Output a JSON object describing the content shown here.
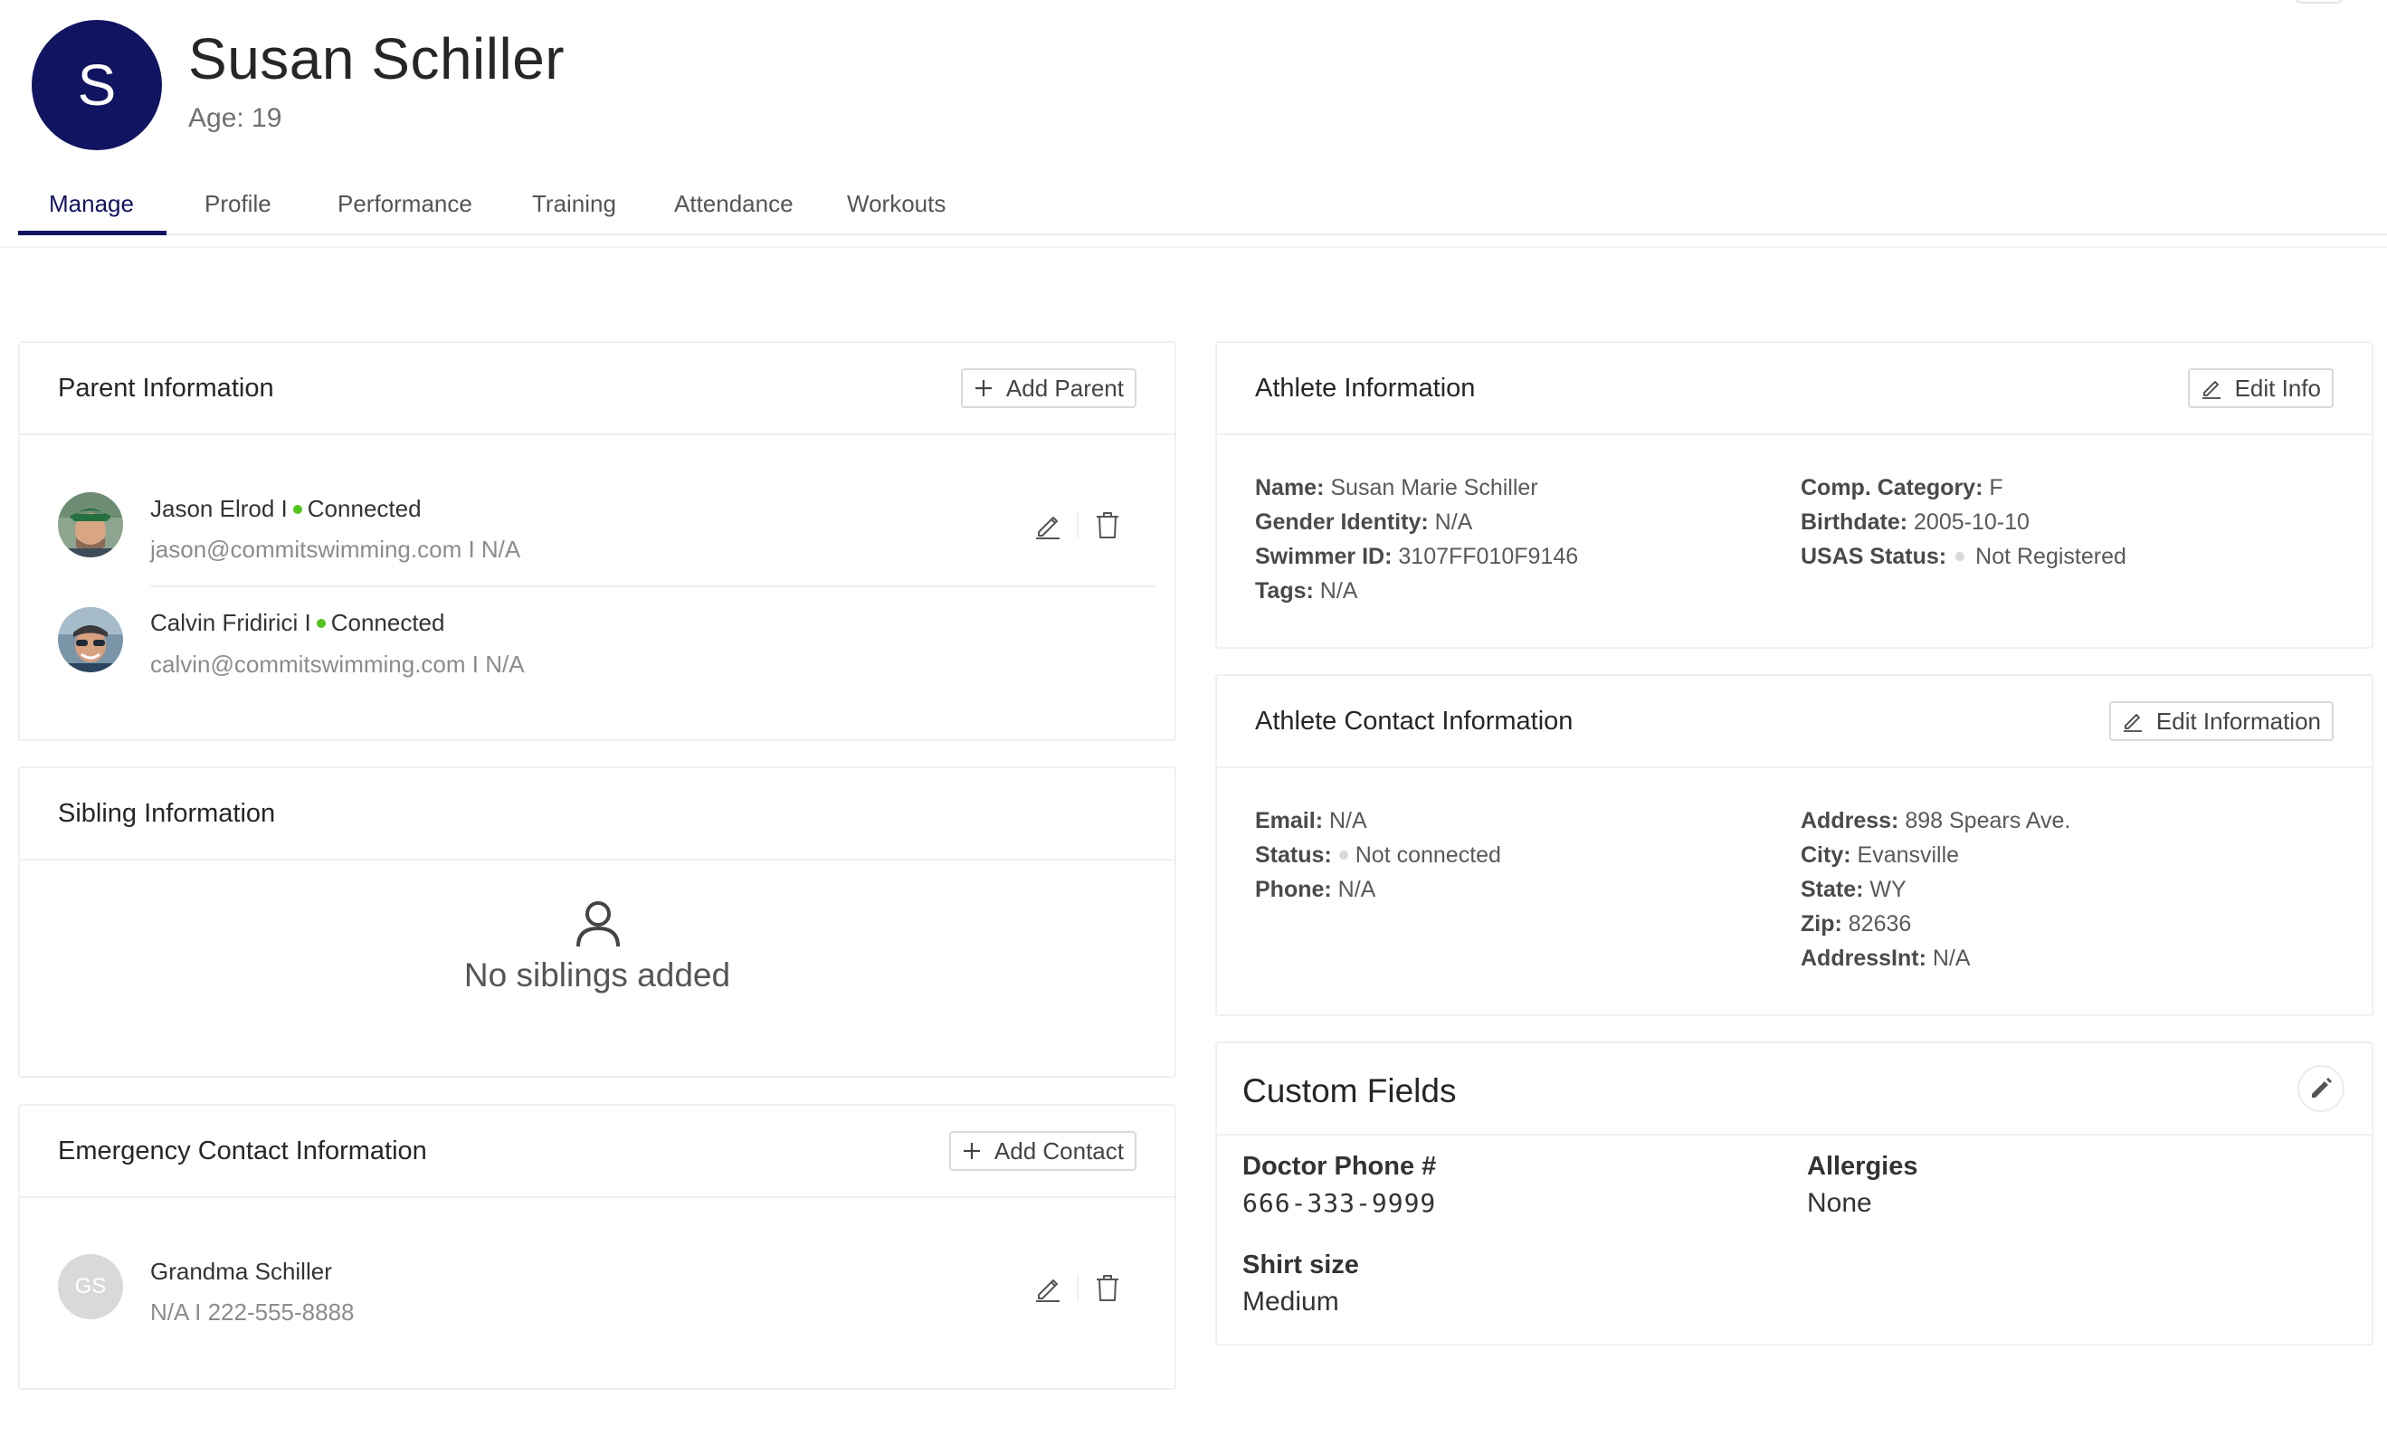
{
  "athlete": {
    "avatar_letter": "S",
    "name": "Susan Schiller",
    "age": "Age: 19"
  },
  "tabs": [
    {
      "label": "Manage"
    },
    {
      "label": "Profile"
    },
    {
      "label": "Performance"
    },
    {
      "label": "Training"
    },
    {
      "label": "Attendance"
    },
    {
      "label": "Workouts"
    }
  ],
  "parent_info": {
    "title": "Parent Information",
    "add_label": "Add Parent",
    "parents": [
      {
        "name": "Jason Elrod",
        "sep": "I",
        "status": "Connected",
        "email_line": "jason@commitswimming.com I N/A"
      },
      {
        "name": "Calvin Fridirici",
        "sep": "I",
        "status": "Connected",
        "email_line": "calvin@commitswimming.com I N/A"
      }
    ],
    "status_color": "#52c41a"
  },
  "sibling_info": {
    "title": "Sibling Information",
    "empty_text": "No siblings added"
  },
  "emergency_info": {
    "title": "Emergency Contact Information",
    "add_label": "Add Contact",
    "contacts": [
      {
        "initials": "GS",
        "name": "Grandma Schiller",
        "sub": "N/A I 222-555-8888"
      }
    ]
  },
  "athlete_info": {
    "title": "Athlete Information",
    "edit_label": "Edit Info",
    "left": [
      {
        "label": "Name:",
        "value": "Susan Marie Schiller"
      },
      {
        "label": "Gender Identity:",
        "value": "N/A"
      },
      {
        "label": "Swimmer ID:",
        "value": "3107FF010F9146"
      },
      {
        "label": "Tags:",
        "value": "N/A"
      }
    ],
    "right": [
      {
        "label": "Comp. Category:",
        "value": "F"
      },
      {
        "label": "Birthdate:",
        "value": "2005-10-10"
      },
      {
        "label": "USAS Status:",
        "value": "Not Registered"
      }
    ]
  },
  "contact_info": {
    "title": "Athlete Contact Information",
    "edit_label": "Edit Information",
    "left": [
      {
        "label": "Email:",
        "value": "N/A"
      },
      {
        "label": "Status:",
        "value": "Not connected"
      },
      {
        "label": "Phone:",
        "value": "N/A"
      }
    ],
    "right": [
      {
        "label": "Address:",
        "value": "898 Spears Ave."
      },
      {
        "label": "City:",
        "value": "Evansville"
      },
      {
        "label": "State:",
        "value": "WY"
      },
      {
        "label": "Zip:",
        "value": "82636"
      },
      {
        "label": "AddressInt:",
        "value": "N/A"
      }
    ]
  },
  "custom_fields": {
    "title": "Custom Fields",
    "fields": [
      {
        "label": "Doctor Phone #",
        "value": "666-333-9999"
      },
      {
        "label": "Allergies",
        "value": "None"
      },
      {
        "label": "Shirt size",
        "value": "Medium"
      }
    ]
  },
  "colors": {
    "brand": "#111460",
    "connected": "#52c41a",
    "inactive_dot": "#d9d9d9"
  },
  "icons": [
    "plus-icon",
    "pencil-icon",
    "trash-icon",
    "user-outline-icon",
    "edit-pencil-icon"
  ]
}
